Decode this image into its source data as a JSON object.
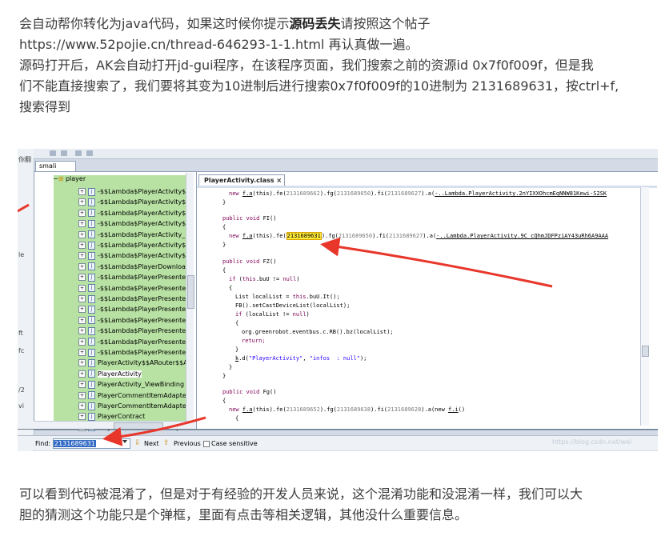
{
  "article": {
    "p1_line1_pre": "会自动帮你转化为java代码，如果这时候你提示",
    "p1_line1_bold": "源码丢失",
    "p1_line1_post": "请按照这个帖子",
    "p1_line2": "https://www.52pojie.cn/thread-646293-1-1.html 再认真做一遍。",
    "p1_line3": "源码打开后，AK会自动打开jd-gui程序，在该程序页面，我们搜索之前的资源id 0x7f0f009f，但是我",
    "p1_line4": "们不能直接搜索了，我们要将其变为10进制后进行搜索0x7f0f009f的10进制为 2131689631，按ctrl+f,",
    "p1_line5": "搜索得到",
    "p2_line1": "可以看到代码被混淆了，但是对于有经验的开发人员来说，这个混淆功能和没混淆一样，我们可以大",
    "p2_line2": "胆的猜测这个功能只是个弹框，里面有点击等相关逻辑，其他没什么重要信息。"
  },
  "screenshot": {
    "left_edge_labels": [
      "你翻",
      "le",
      "ft",
      "fc",
      "/2",
      "vi",
      "翻"
    ],
    "smali_tab": "smali",
    "package_label": "player",
    "tree_items": [
      "-$$Lambda$PlayerActivity$1",
      "-$$Lambda$PlayerActivity$2",
      "-$$Lambda$PlayerActivity$3",
      "-$$Lambda$PlayerActivity$9",
      "-$$Lambda$PlayerActivity_",
      "-$$Lambda$PlayerActivity$c",
      "-$$Lambda$PlayerActivity$y",
      "-$$Lambda$PlayerDownloa",
      "-$$Lambda$PlayerPresente",
      "-$$Lambda$PlayerPresente",
      "-$$Lambda$PlayerPresente",
      "-$$Lambda$PlayerPresente",
      "-$$Lambda$PlayerPresente",
      "-$$Lambda$PlayerPresente",
      "-$$Lambda$PlayerPresente",
      "-$$Lambda$PlayerPresente",
      "PlayerActivity$$ARouter$$At",
      "PlayerActivity",
      "PlayerActivity_ViewBinding",
      "PlayerCommentItemAdapte",
      "PlayerCommentItemAdapte",
      "PlayerContract",
      "PlayerDownloadItemAdapte"
    ],
    "code_tab": "PlayerActivity.class",
    "code_tab_close": "×",
    "code": {
      "l0_a": "new ",
      "l0_b": "f.a",
      "l0_c": "(this).fe(",
      "l0_d": "2131689662",
      "l0_e": ").fg(",
      "l0_f": "2131689650",
      "l0_g": ").fi(",
      "l0_h": "2131689627",
      "l0_i": ").a(",
      "l0_j": "-..Lambda.PlayerActivity.2nYIXXOhcmEqNNW81Kewi-S2SK",
      "l1": "}",
      "l2_kw": "public void ",
      "l2_name": "FI()",
      "l3": "{",
      "l4_a": "new ",
      "l4_b": "f.a",
      "l4_c": "(this).fe(",
      "l4_d": "2131689631",
      "l4_e": ").fg(",
      "l4_f": "2131689650",
      "l4_g": ").fi(",
      "l4_h": "2131689627",
      "l4_i": ").a(",
      "l4_j": "-..Lambda.PlayerActivity.9C_cQhmJDFPziAY43uRh6A9AAA",
      "l5": "}",
      "l6_kw": "public void ",
      "l6_name": "FZ()",
      "l7": "{",
      "l8_kw": "if ",
      "l8_a": "(",
      "l8_this": "this",
      "l8_b": ".buU != ",
      "l8_null": "null",
      "l8_c": ")",
      "l9": "{",
      "l10_a": "List localList = ",
      "l10_this": "this",
      "l10_b": ".buU.It();",
      "l11": "FB().setCastDeviceList(localList);",
      "l12_kw": "if ",
      "l12_a": "(localList != ",
      "l12_null": "null",
      "l12_b": ")",
      "l13": "{",
      "l14": "org.greenrobot.eventbus.c.RB().bz(localList);",
      "l15": "return;",
      "l16": "}",
      "l17_a": "k",
      "l17_b": ".d(",
      "l17_s1": "\"PlayerActivity\"",
      "l17_c": ", ",
      "l17_s2": "\"infos  : null\"",
      "l17_d": ");",
      "l18": "}",
      "l19": "}",
      "l20_kw": "public void ",
      "l20_name": "Fg()",
      "l21": "{",
      "l22_a": "new ",
      "l22_b": "f.a",
      "l22_c": "(this).fe(",
      "l22_d": "2131689652",
      "l22_e": ").fg(",
      "l22_f": "2131689638",
      "l22_g": ").fi(",
      "l22_h": "2131689628",
      "l22_i": ").a(new ",
      "l22_j": "f.i",
      "l22_k": "()",
      "l23": "{"
    },
    "find": {
      "label": "Find:",
      "value": "2131689631",
      "next": "Next",
      "previous": "Previous",
      "case_sensitive": "Case sensitive"
    },
    "watermark": "https://blog.csdn.net/wei",
    "colors": {
      "tree_bg": "#b8e2a3",
      "arrow": "#e8362b",
      "highlight": "#ffeb3b",
      "keyword": "#7f0055",
      "string": "#2a00ff"
    }
  }
}
